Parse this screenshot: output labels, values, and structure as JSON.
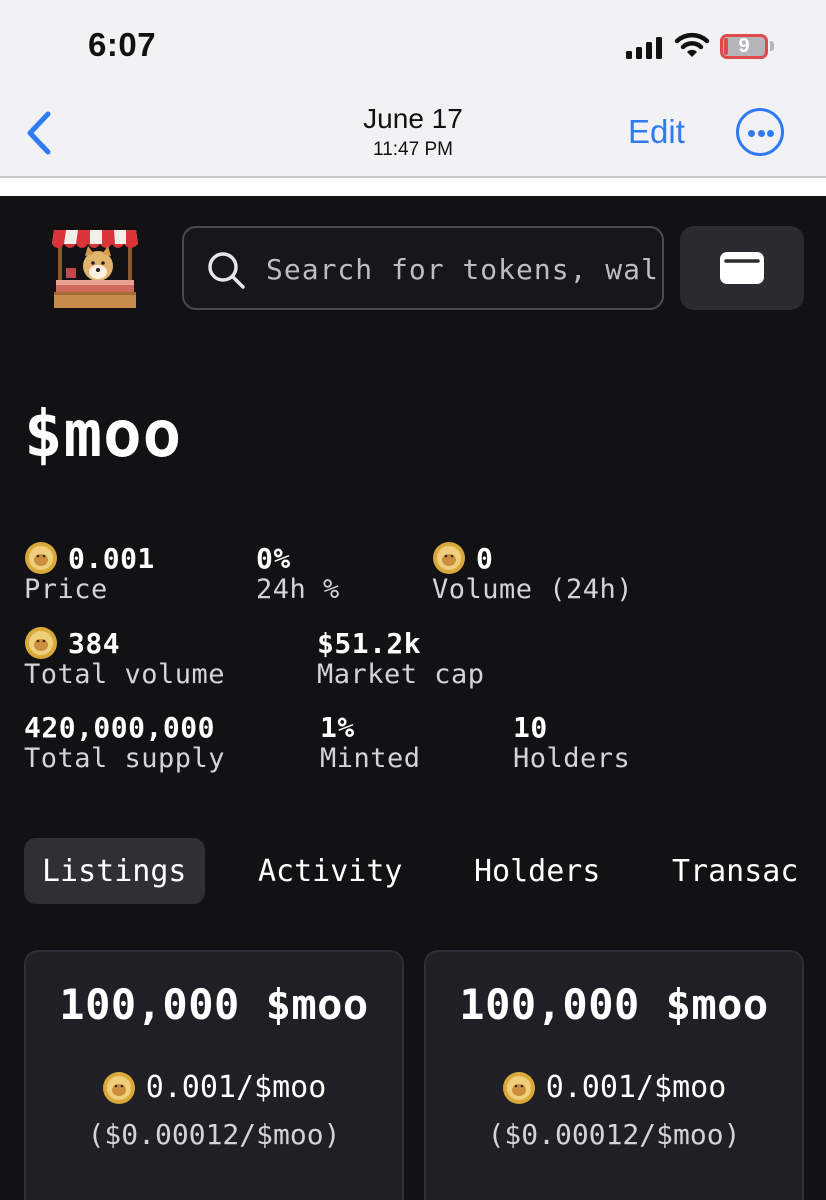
{
  "status_bar": {
    "time": "6:07",
    "battery": "9"
  },
  "nav": {
    "date": "June 17",
    "time": "11:47 PM",
    "edit": "Edit"
  },
  "search": {
    "placeholder": "Search for tokens, wallets"
  },
  "token": {
    "title": "$moo"
  },
  "stats": {
    "price": {
      "value": "0.001",
      "label": "Price"
    },
    "change": {
      "value": "0%",
      "label": "24h %"
    },
    "volume24": {
      "value": "0",
      "label": "Volume (24h)"
    },
    "total_volume": {
      "value": "384",
      "label": "Total volume"
    },
    "market_cap": {
      "value": "$51.2k",
      "label": "Market cap"
    },
    "total_supply": {
      "value": "420,000,000",
      "label": "Total supply"
    },
    "minted": {
      "value": "1%",
      "label": "Minted"
    },
    "holders": {
      "value": "10",
      "label": "Holders"
    }
  },
  "tabs": [
    {
      "label": "Listings",
      "active": true
    },
    {
      "label": "Activity"
    },
    {
      "label": "Holders"
    },
    {
      "label": "Transac"
    }
  ],
  "listings": [
    {
      "amount": "100,000 $moo",
      "price": "0.001/$moo",
      "usd": "($0.00012/$moo)"
    },
    {
      "amount": "100,000 $moo",
      "price": "0.001/$moo",
      "usd": "($0.00012/$moo)"
    }
  ],
  "colors": {
    "accent": "#2f7bf5",
    "background": "#121214",
    "card": "#1f1f25",
    "tab_active": "#2f3036",
    "coin": "#d9a93c"
  },
  "icons": [
    "chevron-left-icon",
    "more-icon",
    "signal-icon",
    "wifi-icon",
    "battery-icon",
    "search-icon",
    "wallet-icon",
    "dogecoin-icon",
    "market-stall-logo"
  ]
}
